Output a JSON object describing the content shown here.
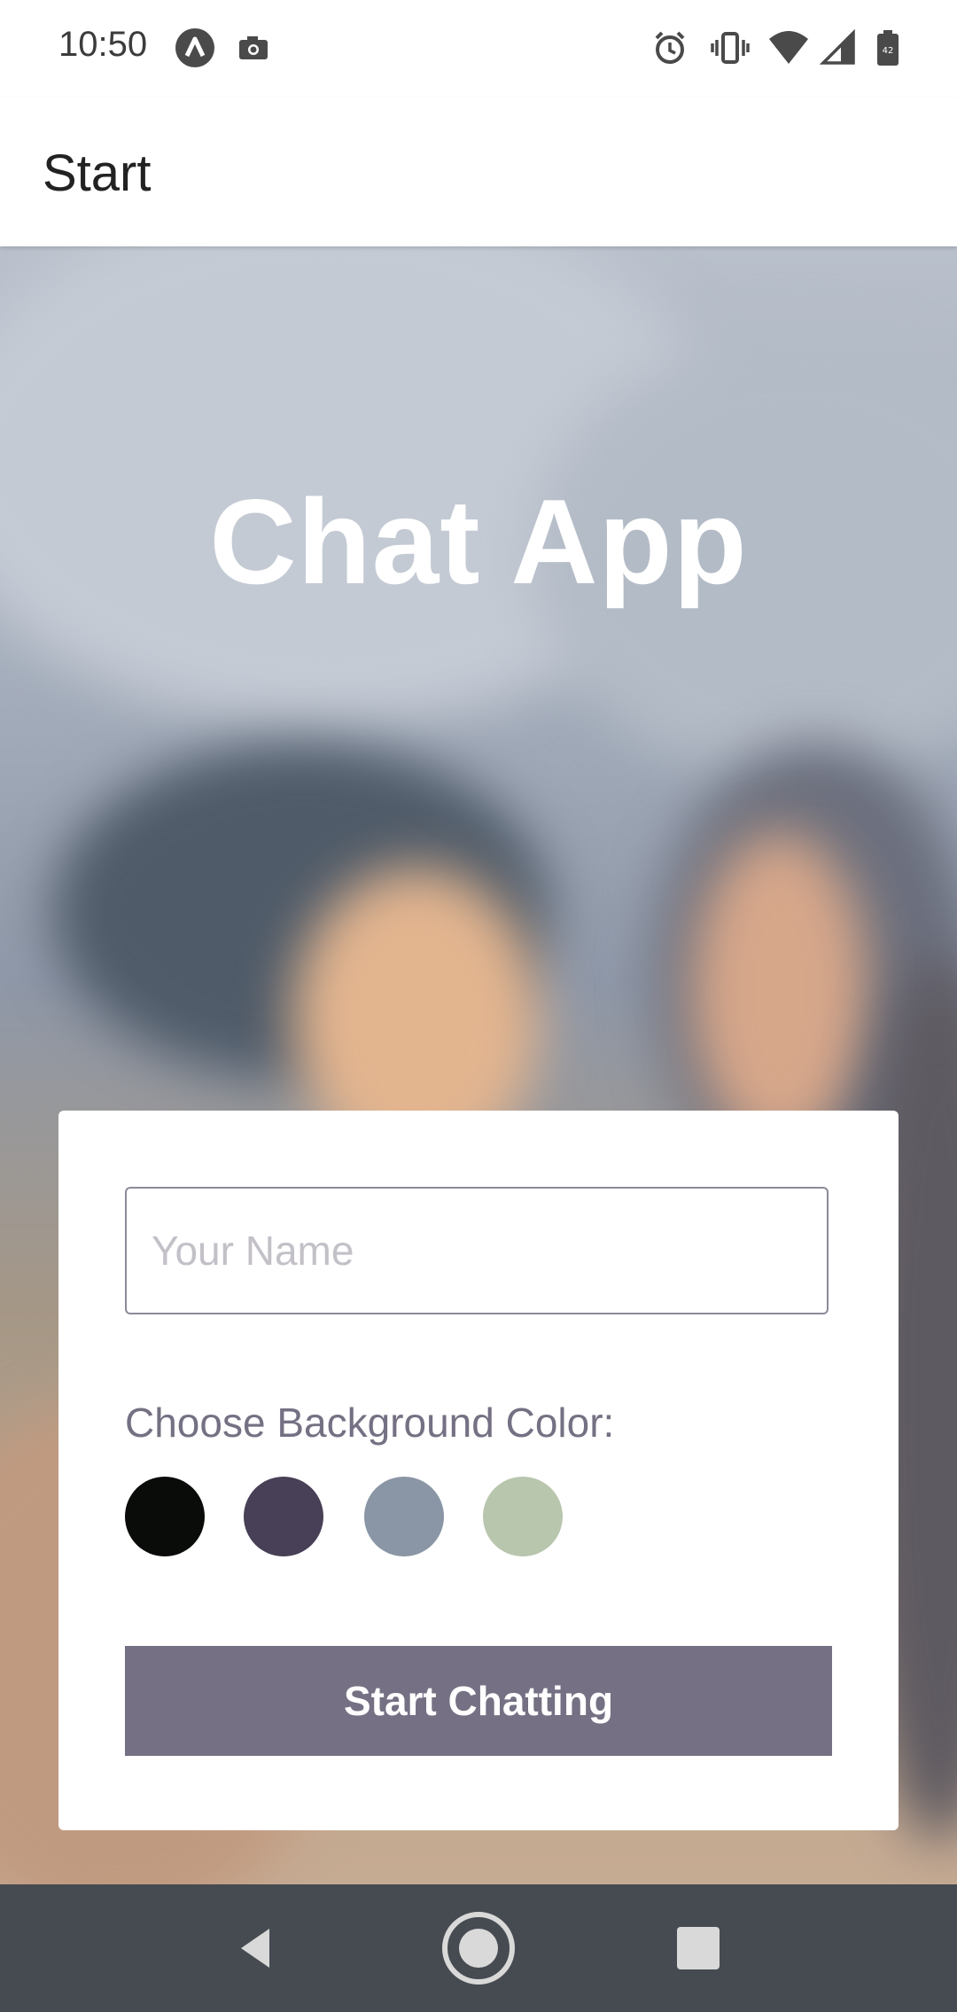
{
  "status_bar": {
    "time": "10:50",
    "left_icons": [
      "app-a-icon",
      "camera-icon"
    ],
    "right_icons": [
      "alarm-icon",
      "vibrate-icon",
      "wifi-icon",
      "signal-icon",
      "battery-icon"
    ]
  },
  "app_bar": {
    "title": "Start"
  },
  "hero": {
    "title": "Chat App"
  },
  "form": {
    "name_placeholder": "Your Name",
    "name_value": "",
    "color_label": "Choose Background Color:",
    "colors": [
      "#090C08",
      "#474056",
      "#8A95A5",
      "#B9C6AE"
    ],
    "start_label": "Start Chatting",
    "button_color": "#757083"
  },
  "nav_bar": {
    "icons": [
      "back-icon",
      "home-icon",
      "recents-icon"
    ]
  }
}
